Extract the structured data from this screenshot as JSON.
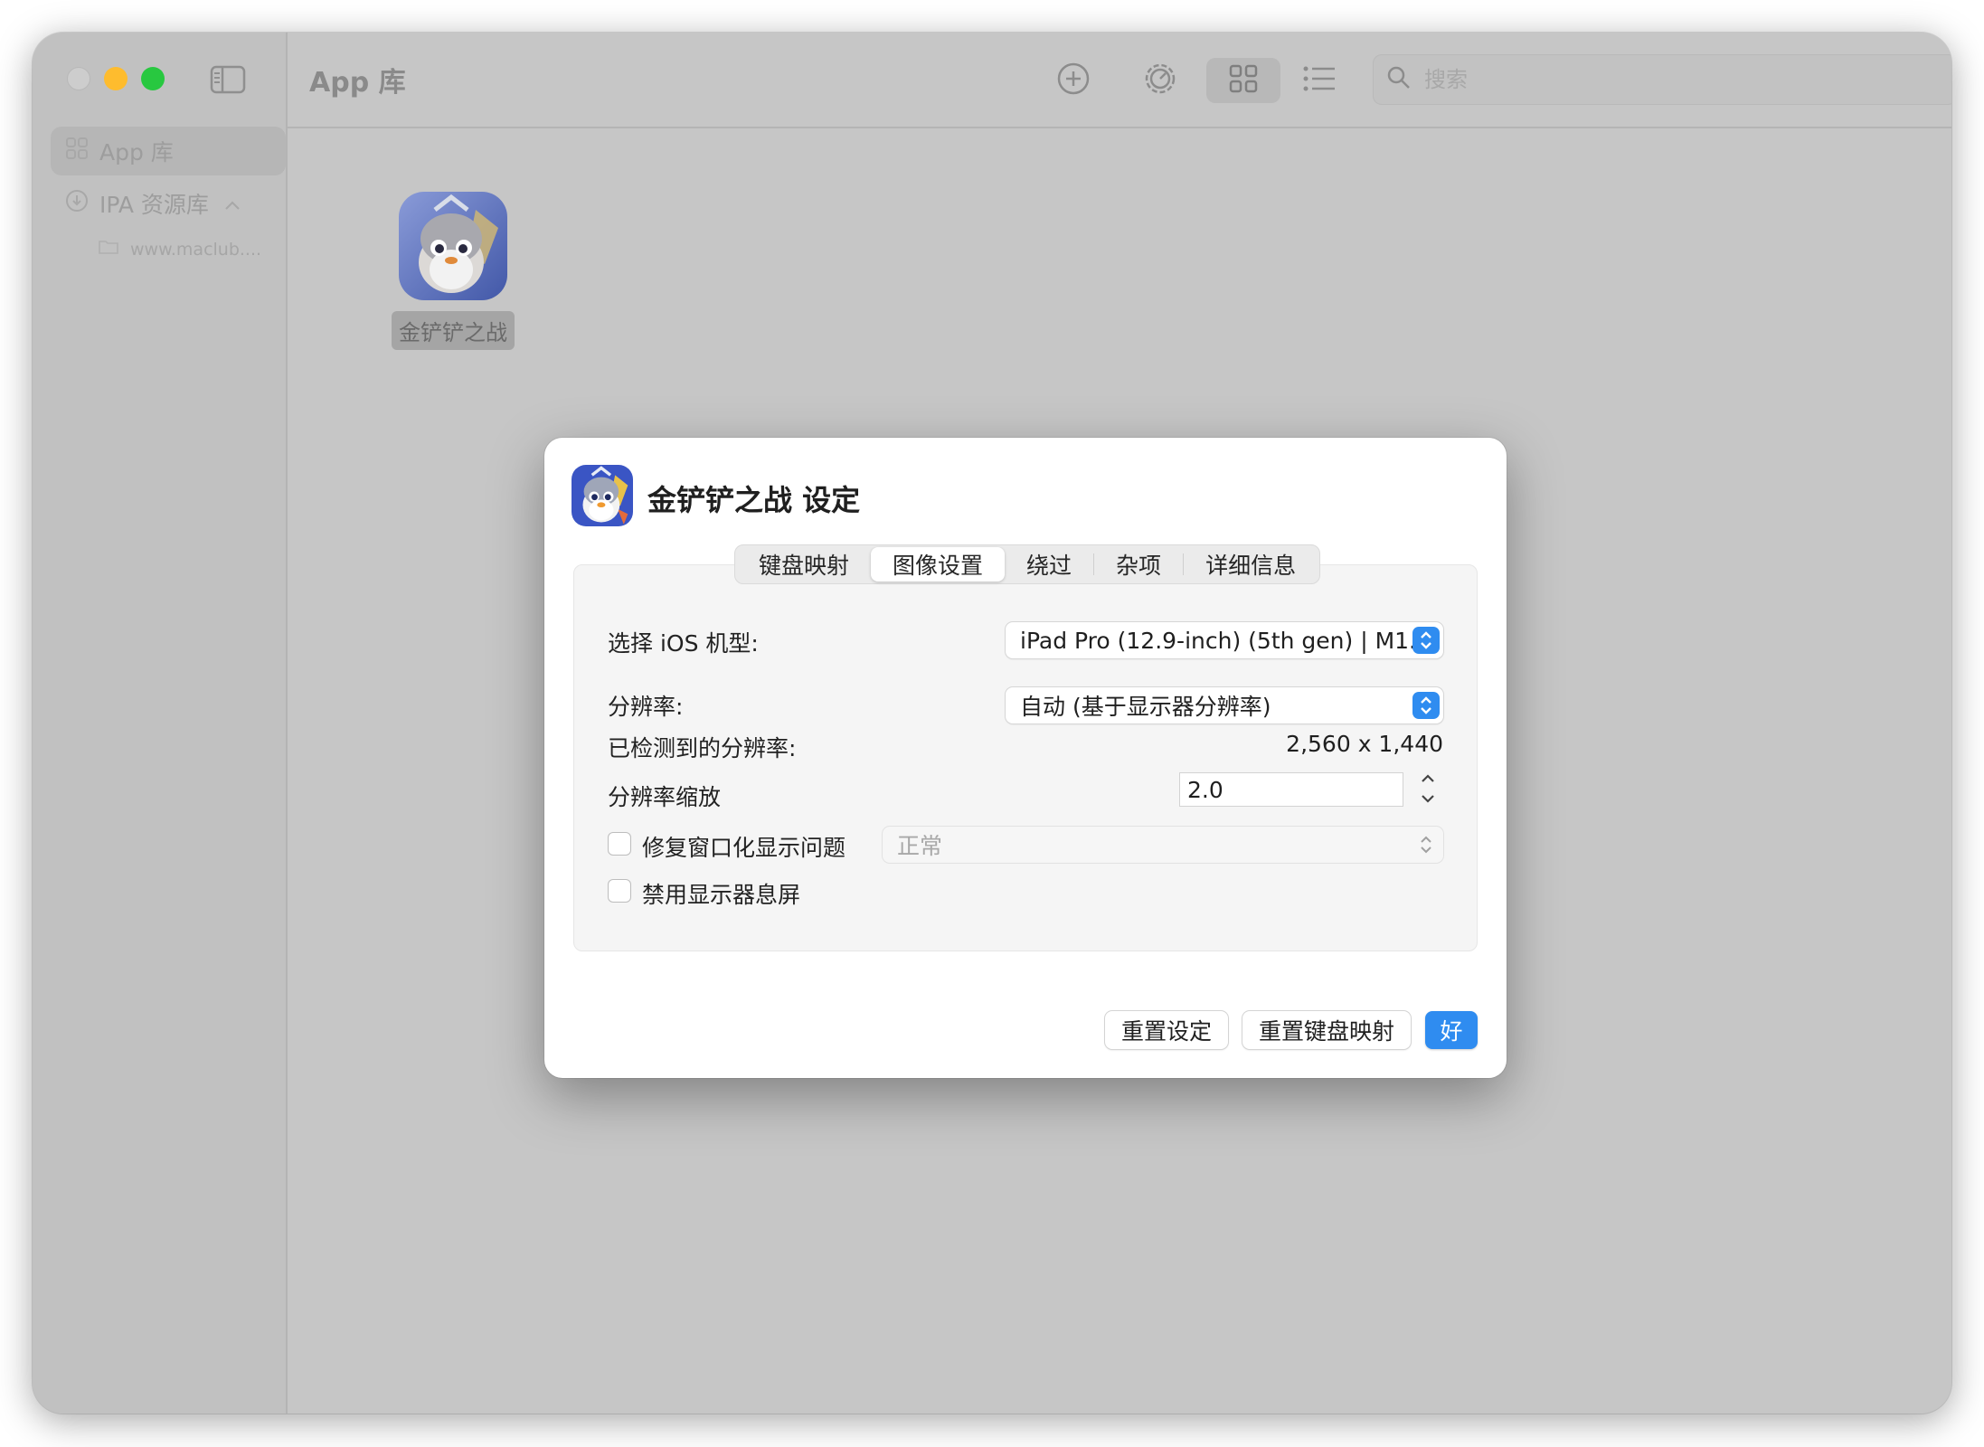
{
  "window": {
    "title": "App 库"
  },
  "sidebar": {
    "items": [
      {
        "label": "App 库",
        "icon": "grid-icon",
        "selected": true
      },
      {
        "label": "IPA 资源库",
        "icon": "download-icon",
        "expanded": true
      }
    ],
    "sub_items": [
      {
        "label": "www.maclub....",
        "icon": "folder-icon"
      }
    ]
  },
  "toolbar": {
    "title": "App 库",
    "buttons": [
      "add-icon",
      "settings-icon",
      "grid-view-icon",
      "list-view-icon"
    ],
    "search_placeholder": "搜索"
  },
  "library": {
    "apps": [
      {
        "name": "金铲铲之战"
      }
    ]
  },
  "dialog": {
    "title": "金铲铲之战 设定",
    "tabs": [
      {
        "label": "键盘映射"
      },
      {
        "label": "图像设置",
        "selected": true
      },
      {
        "label": "绕过"
      },
      {
        "label": "杂项"
      },
      {
        "label": "详细信息"
      }
    ],
    "fields": {
      "ios_model_label": "选择 iOS 机型:",
      "ios_model_value": "iPad Pro (12.9-inch) (5th gen) | M1...",
      "resolution_label": "分辨率:",
      "resolution_value": "自动 (基于显示器分辨率)",
      "detected_label": "已检测到的分辨率:",
      "detected_value": "2,560 x 1,440",
      "scale_label": "分辨率缩放",
      "scale_value": "2.0",
      "fix_window_label": "修复窗口化显示问题",
      "fix_window_checked": false,
      "fix_window_mode": "正常",
      "disable_sleep_label": "禁用显示器息屏",
      "disable_sleep_checked": false
    },
    "buttons": {
      "reset_settings": "重置设定",
      "reset_keymap": "重置键盘映射",
      "ok": "好"
    }
  },
  "colors": {
    "accent": "#2f8cf0",
    "traffic_min": "#febc2e",
    "traffic_max": "#28c840"
  }
}
